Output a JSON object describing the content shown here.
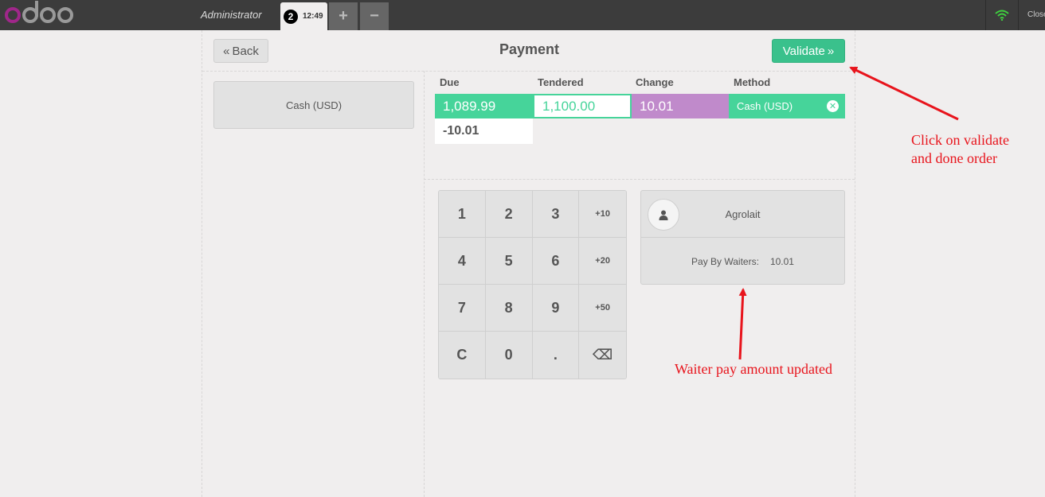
{
  "topbar": {
    "user": "Administrator",
    "order_sequence": "2",
    "order_time": "12:49",
    "add_order": "+",
    "remove_order": "−",
    "close": "Close"
  },
  "payment": {
    "back_label": "Back",
    "title": "Payment",
    "validate_label": "Validate",
    "method_button": "Cash (USD)",
    "columns": {
      "due": "Due",
      "tendered": "Tendered",
      "change": "Change",
      "method": "Method"
    },
    "line": {
      "due": "1,089.99",
      "tendered": "1,100.00",
      "change": "10.01",
      "method": "Cash (USD)"
    },
    "remaining": "-10.01"
  },
  "numpad": {
    "keys": [
      "1",
      "2",
      "3",
      "+10",
      "4",
      "5",
      "6",
      "+20",
      "7",
      "8",
      "9",
      "+50",
      "C",
      "0",
      ".",
      "⌫"
    ]
  },
  "customer": {
    "name": "Agrolait",
    "waiter_label": "Pay By Waiters:",
    "waiter_amount": "10.01"
  },
  "annotations": {
    "validate_note": "Click on validate and done order",
    "waiter_note": "Waiter pay amount updated"
  },
  "colors": {
    "accent_green": "#46d49a",
    "change_purple": "#c08acb",
    "annotation_red": "#e8141c"
  }
}
